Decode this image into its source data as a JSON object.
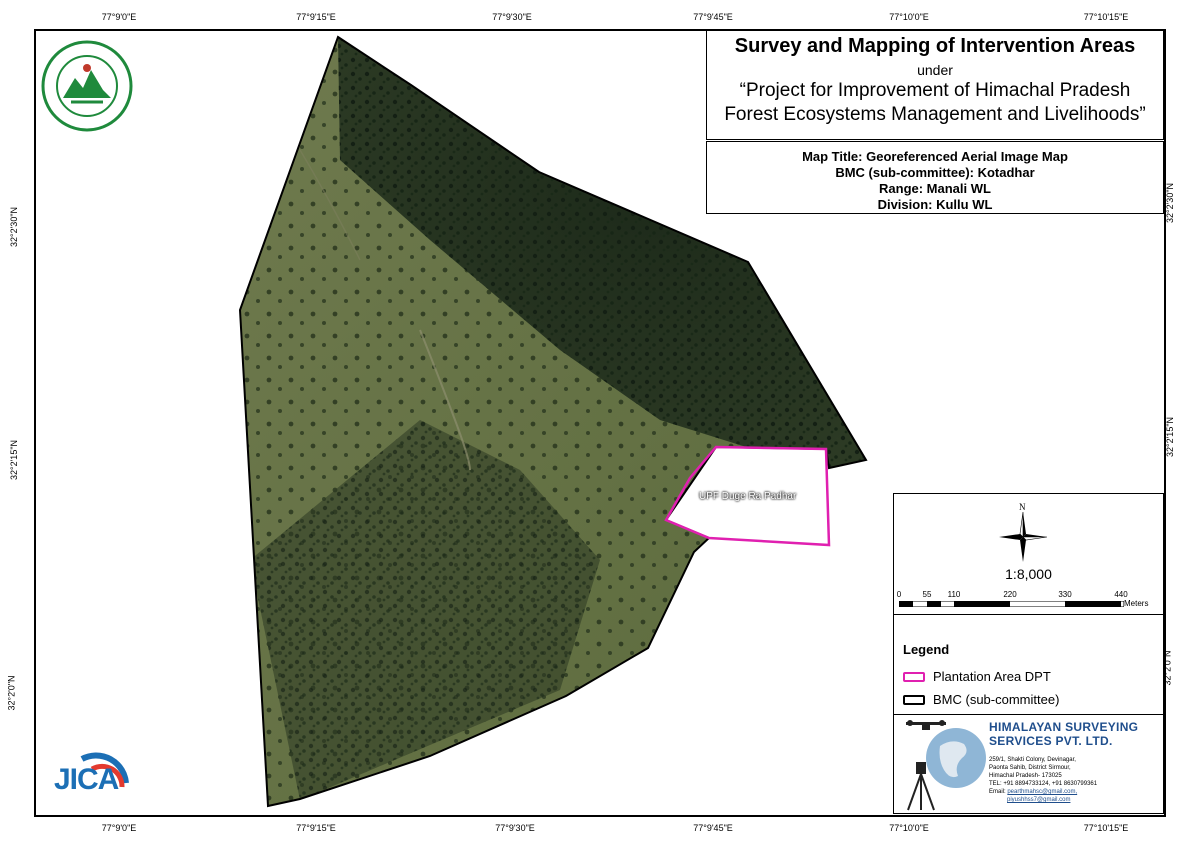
{
  "graticule": {
    "top_labels": [
      "77°9'0\"E",
      "77°9'15\"E",
      "77°9'30\"E",
      "77°9'45\"E",
      "77°10'0\"E",
      "77°10'15\"E"
    ],
    "bottom_labels": [
      "77°9'0\"E",
      "77°9'15\"E",
      "77°9'30\"E",
      "77°9'45\"E",
      "77°10'0\"E",
      "77°10'15\"E"
    ],
    "left_labels": [
      "32°2'30\"N",
      "32°2'15\"N",
      "32°2'0\"N"
    ],
    "right_labels": [
      "32°2'30\"N",
      "32°2'15\"N",
      "32°2'0\"N"
    ]
  },
  "title": {
    "main": "Survey and Mapping of Intervention Areas",
    "under": "under",
    "project_line1": "“Project for Improvement of Himachal Pradesh",
    "project_line2": "Forest Ecosystems Management and Livelihoods”"
  },
  "info": {
    "map_title": "Map Title: Georeferenced Aerial Image Map",
    "bmc": "BMC (sub-committee): Kotadhar",
    "range": "Range: Manali WL",
    "division": "Division: Kullu WL"
  },
  "north_arrow": {
    "label": "N"
  },
  "scale": {
    "ratio": "1:8,000",
    "ticks": [
      "0",
      "55",
      "110",
      "220",
      "330",
      "440"
    ],
    "unit": "Meters"
  },
  "legend": {
    "title": "Legend",
    "items": [
      {
        "label": "Plantation Area DPT",
        "color": "#e020b0"
      },
      {
        "label": "BMC (sub-committee)",
        "color": "#000000"
      }
    ]
  },
  "map": {
    "plantation_label": "UPF Duge Ra Padhar",
    "plantation_color": "#e020b0",
    "boundary_color": "#000000"
  },
  "company": {
    "name_line1": "HIMALAYAN SURVEYING",
    "name_line2": "SERVICES PVT. LTD.",
    "address": [
      "259/1, Shakti Colony, Devinagar,",
      "Paonta Sahib, District Sirmour,",
      "Himachal Pradesh- 173025",
      "TEL: +91 8894733124, +91 8630799361"
    ],
    "email_label": "Email:",
    "emails": [
      "pearthmahsc@gmail.com,",
      "piyushhss7@gmail.com"
    ]
  },
  "logos": {
    "jica": "JICA",
    "hp_forest": "HP Forest Department emblem"
  }
}
